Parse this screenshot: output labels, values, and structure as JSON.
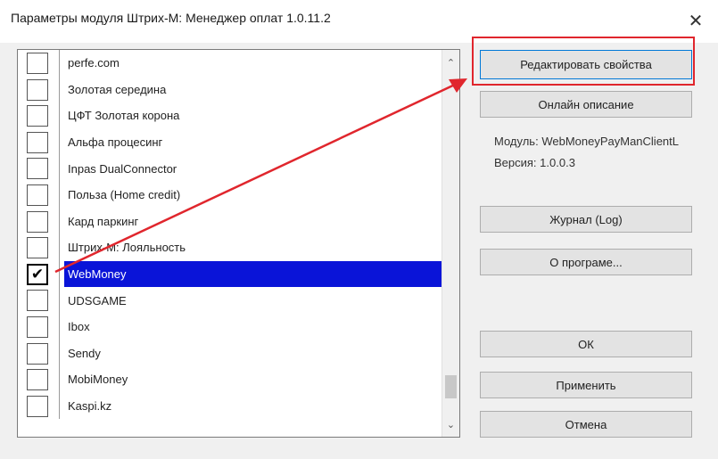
{
  "window": {
    "title": "Параметры модуля Штрих-М: Менеджер оплат 1.0.11.2",
    "close_glyph": "✕"
  },
  "modules": {
    "items": [
      {
        "label": "perfe.com",
        "checked": false
      },
      {
        "label": "Золотая середина",
        "checked": false
      },
      {
        "label": "ЦФТ Золотая корона",
        "checked": false
      },
      {
        "label": "Альфа процесинг",
        "checked": false
      },
      {
        "label": "Inpas DualConnector",
        "checked": false
      },
      {
        "label": "Польза (Home credit)",
        "checked": false
      },
      {
        "label": "Кард паркинг",
        "checked": false
      },
      {
        "label": "Штрих-М: Лояльность",
        "checked": false
      },
      {
        "label": "WebMoney",
        "checked": true
      },
      {
        "label": "UDSGAME",
        "checked": false
      },
      {
        "label": "Ibox",
        "checked": false
      },
      {
        "label": "Sendy",
        "checked": false
      },
      {
        "label": "MobiMoney",
        "checked": false
      },
      {
        "label": "Kaspi.kz",
        "checked": false
      }
    ],
    "selected_index": 8,
    "check_glyph": "✔",
    "scroll_up_glyph": "⌃",
    "scroll_down_glyph": "⌄"
  },
  "buttons": {
    "edit_properties": "Редактировать свойства",
    "online_description": "Онлайн описание",
    "log": "Журнал (Log)",
    "about": "О програме...",
    "ok": "ОК",
    "apply": "Применить",
    "cancel": "Отмена"
  },
  "module_info": {
    "module_label": "Модуль:",
    "module_value": "WebMoneyPayManClientL",
    "version_label": "Версия:",
    "version_value": "1.0.0.3"
  },
  "annotation": {
    "color": "#e0262d"
  }
}
